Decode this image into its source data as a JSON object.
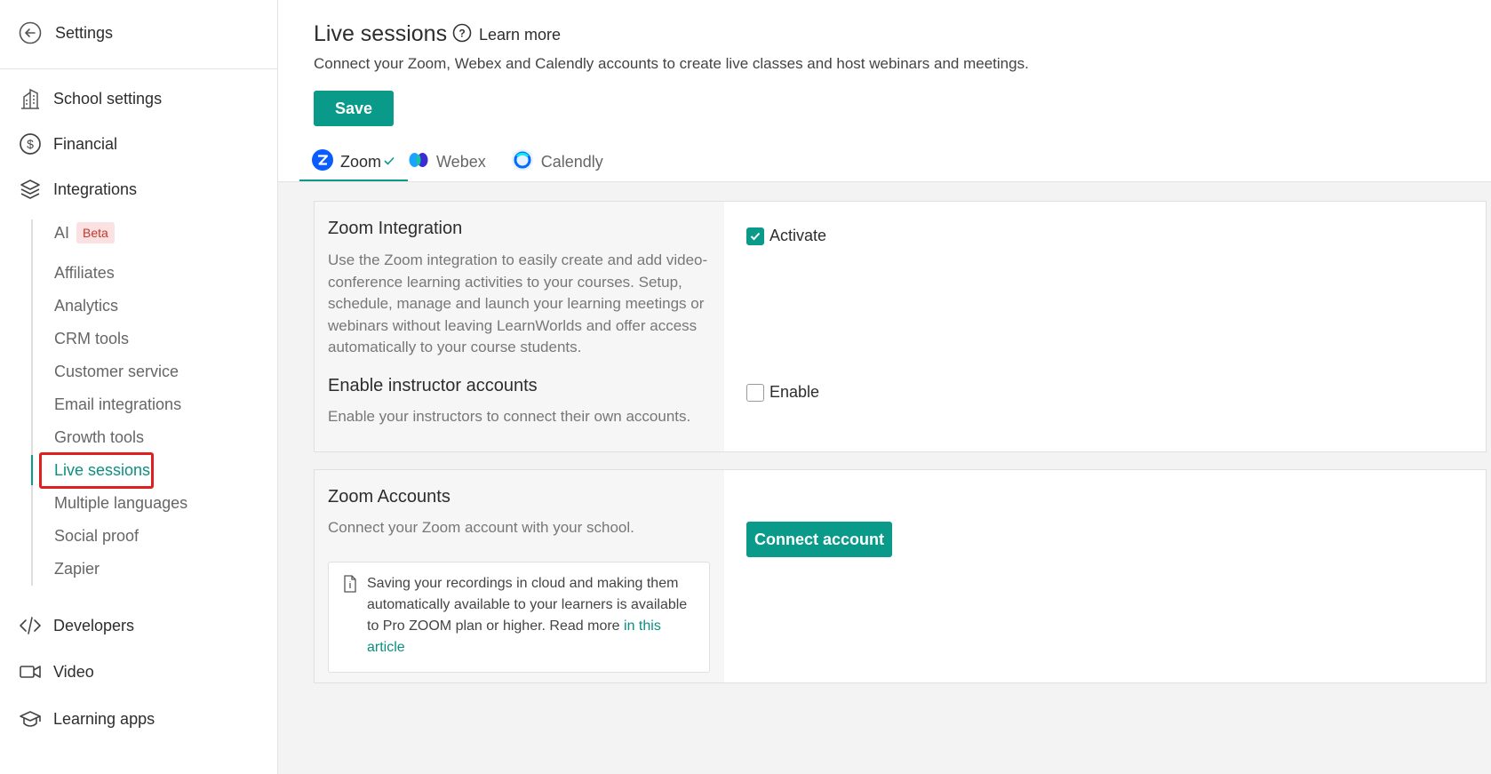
{
  "sidebar": {
    "back_label": "Settings",
    "sections": [
      {
        "label": "School settings",
        "icon": "building-icon"
      },
      {
        "label": "Financial",
        "icon": "dollar-circle-icon"
      },
      {
        "label": "Integrations",
        "icon": "layers-icon"
      }
    ],
    "integrations_items": [
      {
        "label": "AI",
        "badge": "Beta"
      },
      {
        "label": "Affiliates"
      },
      {
        "label": "Analytics"
      },
      {
        "label": "CRM tools"
      },
      {
        "label": "Customer service"
      },
      {
        "label": "Email integrations"
      },
      {
        "label": "Growth tools"
      },
      {
        "label": "Live sessions",
        "active": true
      },
      {
        "label": "Multiple languages"
      },
      {
        "label": "Social proof"
      },
      {
        "label": "Zapier"
      }
    ],
    "bottom_sections": [
      {
        "label": "Developers",
        "icon": "code-icon"
      },
      {
        "label": "Video",
        "icon": "video-camera-icon"
      },
      {
        "label": "Learning apps",
        "icon": "graduation-cap-icon"
      }
    ]
  },
  "header": {
    "title": "Live sessions",
    "learn_more": "Learn more",
    "subtitle": "Connect your Zoom, Webex and Calendly accounts to create live classes and host webinars and meetings.",
    "save_label": "Save"
  },
  "tabs": [
    {
      "label": "Zoom",
      "active": true,
      "connected": true
    },
    {
      "label": "Webex"
    },
    {
      "label": "Calendly"
    }
  ],
  "integration_card": {
    "title": "Zoom Integration",
    "description": "Use the Zoom integration to easily create and add video-conference learning activities to your courses. Setup, schedule, manage and launch your learning meetings or webinars without leaving LearnWorlds and offer access automatically to your course students.",
    "activate_label": "Activate",
    "activate_checked": true,
    "instructor_title": "Enable instructor accounts",
    "instructor_desc": "Enable your instructors to connect their own accounts.",
    "enable_label": "Enable",
    "enable_checked": false
  },
  "accounts_card": {
    "title": "Zoom Accounts",
    "description": "Connect your Zoom account with your school.",
    "info_text": "Saving your recordings in cloud and making them automatically available to your learners is available to Pro ZOOM plan or higher. Read more ",
    "info_link": "in this article",
    "connect_label": "Connect account"
  },
  "colors": {
    "accent": "#0a9a8a",
    "highlight": "#e01f1f",
    "beta_bg": "#fbe1e1"
  }
}
